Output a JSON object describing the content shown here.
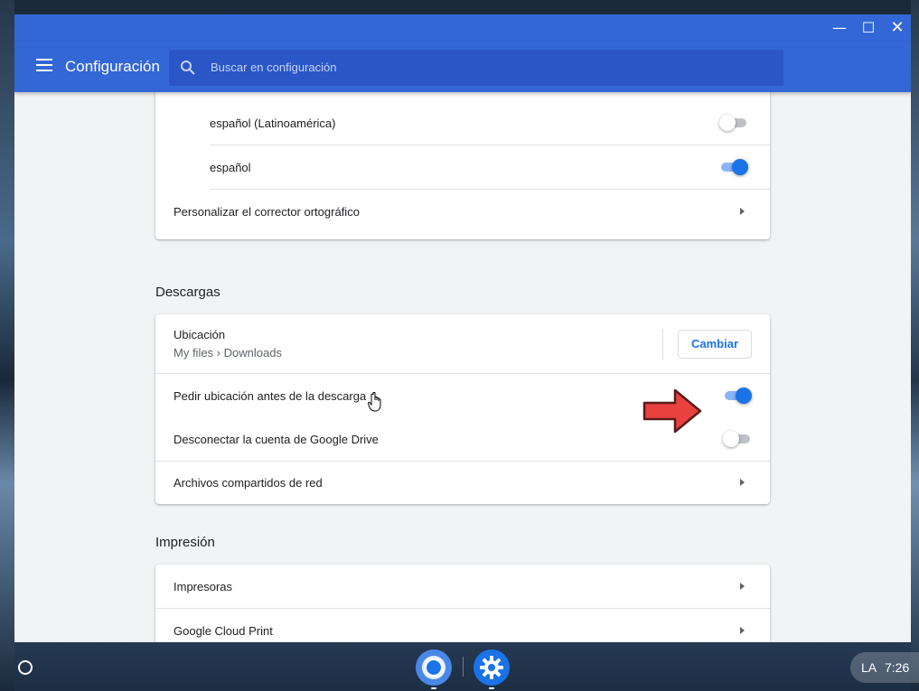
{
  "window": {
    "controls": {
      "minimize": "—",
      "maximize": "☐",
      "close": "✕"
    }
  },
  "appbar": {
    "title": "Configuración",
    "search_placeholder": "Buscar en configuración"
  },
  "spellcheck": {
    "items": [
      {
        "label": "español (Latinoamérica)",
        "enabled": false
      },
      {
        "label": "español",
        "enabled": true
      }
    ],
    "customize_label": "Personalizar el corrector ortográfico"
  },
  "downloads": {
    "section_title": "Descargas",
    "location_label": "Ubicación",
    "location_path": "My files › Downloads",
    "change_button": "Cambiar",
    "ask_location_label": "Pedir ubicación antes de la descarga",
    "ask_location_enabled": true,
    "disconnect_drive_label": "Desconectar la cuenta de Google Drive",
    "disconnect_drive_enabled": false,
    "network_shares_label": "Archivos compartidos de red"
  },
  "printing": {
    "section_title": "Impresión",
    "printers_label": "Impresoras",
    "cloud_print_label": "Google Cloud Print"
  },
  "shelf": {
    "status_lang": "LA",
    "status_time": "7:26"
  },
  "colors": {
    "appbar": "#3367d6",
    "toggle_on": "#1a73e8",
    "annotation_arrow": "#e8413f"
  }
}
